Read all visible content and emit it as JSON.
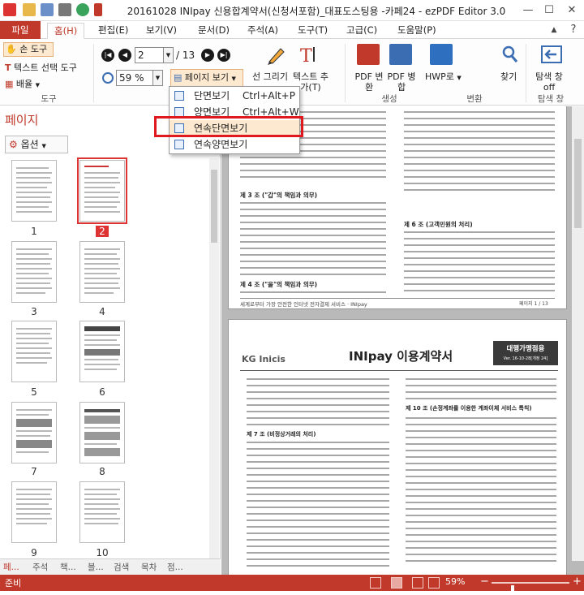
{
  "window": {
    "title": "20161028 INIpay 신용합계약서(신청서포함)_대표도스팅용 -카페24 - ezPDF Editor 3.0",
    "minimize": "—",
    "maximize": "☐",
    "close": "✕"
  },
  "tabs": [
    "파일(F)",
    "홈(H)",
    "편집(E)",
    "보기(V)",
    "문서(D)",
    "주석(A)",
    "도구(T)",
    "고급(C)",
    "도움말(P)"
  ],
  "ribbon": {
    "hand_tool": "손 도구",
    "text_select": "텍스트 선택 도구",
    "arrange": "배율",
    "tools_group": "도구",
    "page_number": "2",
    "page_total": "/ 13",
    "zoom": "59 %",
    "page_view": "페이지 보기",
    "line_draw": "선 그리기",
    "text_add": "텍스트 추가(T)",
    "pdf_convert": "PDF 변환",
    "pdf_merge": "PDF 병합",
    "hwp_convert": "HWP로",
    "find": "찾기",
    "nav_tab": "탐색 창 off",
    "create_group": "생성",
    "convert_group": "변환",
    "nav_group": "탐색 창"
  },
  "view_menu": {
    "items": [
      {
        "label": "단면보기",
        "shortcut": "Ctrl+Alt+P"
      },
      {
        "label": "양면보기",
        "shortcut": "Ctrl+Alt+W"
      },
      {
        "label": "연속단면보기",
        "shortcut": ""
      },
      {
        "label": "연속양면보기",
        "shortcut": ""
      }
    ]
  },
  "left_panel": {
    "title": "페이지",
    "options": "옵션",
    "thumbnails": [
      "1",
      "2",
      "3",
      "4",
      "5",
      "6",
      "7",
      "8",
      "9",
      "10"
    ]
  },
  "bottom_tabs": [
    "페...",
    "주석",
    "책...",
    "블...",
    "검색",
    "목차",
    "점..."
  ],
  "document": {
    "page1_heading_3": "제 3 조 (\"갑\"의 책임과 의무)",
    "page1_heading_4": "제 4 조 (\"을\"의 책임과 의무)",
    "page1_heading_6": "제 6 조 (고객민원의 처리)",
    "page1_footer": "세계로부터 가장 안전한 인터넷 전자결제 서비스 · INIpay",
    "page1_pagenum": "페이지 1 / 13",
    "page2_logo": "KG Inicis",
    "page2_title": "INIpay 이용계약서",
    "page2_badge": "대행가맹점용",
    "page2_badge_sub": "Ver. 16-10-28[개정 24]",
    "page2_heading_7": "제 7 조 (비정상거래의 처리)",
    "page2_heading_10": "제 10 조 (손정계좌를 이용한 계좌이체 서비스 특칙)"
  },
  "status": {
    "ready": "준비",
    "zoom": "59%"
  }
}
